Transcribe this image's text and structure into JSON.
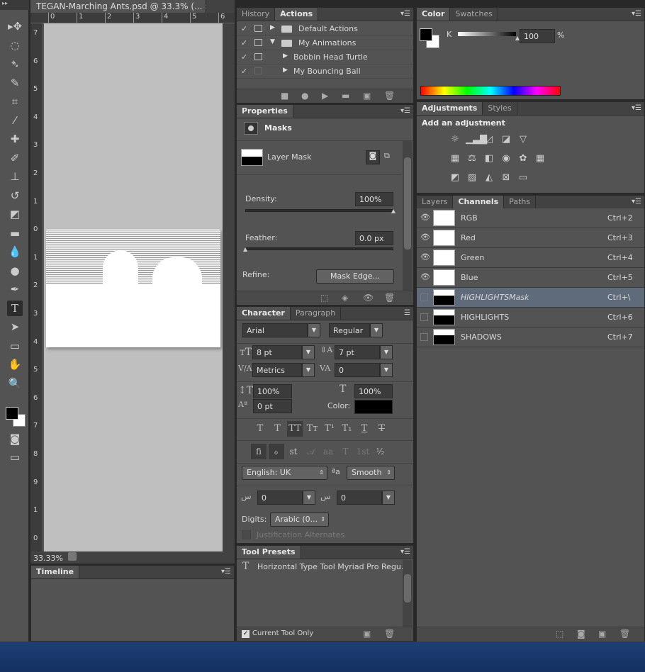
{
  "document": {
    "tab_title": "TEGAN-Marching Ants.psd @ 33.3% (...",
    "zoom": "33.33%",
    "ruler_top": [
      "0",
      "1",
      "2",
      "3",
      "4",
      "5",
      "6"
    ],
    "ruler_left": [
      "7",
      "6",
      "5",
      "4",
      "3",
      "2",
      "1",
      "0",
      "1",
      "2",
      "3",
      "4",
      "5",
      "6",
      "7",
      "8",
      "9",
      "1",
      "0"
    ]
  },
  "timeline": {
    "title": "Timeline"
  },
  "tools": [
    "move-icon",
    "marquee-icon",
    "lasso-icon",
    "quick-select-icon",
    "crop-icon",
    "eyedropper-icon",
    "healing-icon",
    "brush-icon",
    "stamp-icon",
    "history-brush-icon",
    "eraser-icon",
    "gradient-icon",
    "blur-icon",
    "dodge-icon",
    "pen-icon",
    "type-icon",
    "path-select-icon",
    "rectangle-icon",
    "hand-icon",
    "zoom-icon"
  ],
  "history_panel": {
    "tabs": [
      "History",
      "Actions"
    ],
    "actions": [
      {
        "label": "Default Actions",
        "folder": true,
        "expanded": false,
        "indent": 0
      },
      {
        "label": "My Animations",
        "folder": true,
        "expanded": true,
        "indent": 0
      },
      {
        "label": "Bobbin Head Turtle",
        "folder": false,
        "expanded": false,
        "indent": 1
      },
      {
        "label": "My Bouncing Ball",
        "folder": false,
        "expanded": false,
        "indent": 1
      }
    ]
  },
  "properties": {
    "tab": "Properties",
    "type": "Masks",
    "layer_mask_label": "Layer Mask",
    "density_label": "Density:",
    "density": "100%",
    "density_value": 100,
    "feather_label": "Feather:",
    "feather": "0.0 px",
    "feather_value": 0,
    "refine_label": "Refine:",
    "mask_edge_button": "Mask Edge..."
  },
  "character": {
    "tabs": [
      "Character",
      "Paragraph"
    ],
    "font": "Arial",
    "style": "Regular",
    "size": "8 pt",
    "leading": "7 pt",
    "kerning": "Metrics",
    "tracking": "0",
    "vscale": "100%",
    "hscale": "100%",
    "baseline": "0 pt",
    "color_label": "Color:",
    "color": "#000000",
    "type_buttons": [
      "T",
      "T",
      "TT",
      "Tт",
      "T¹",
      "T₁",
      "T",
      "T"
    ],
    "opentype_buttons": [
      "ﬁ",
      "ℴ",
      "st",
      "𝒜",
      "aa",
      "T",
      "1st",
      "½"
    ],
    "language": "English: UK",
    "aa_icon": "ªa",
    "antialias": "Smooth",
    "arabic1": "0",
    "arabic2": "0",
    "digits_label": "Digits:",
    "digits": "Arabic (0...",
    "justification_label": "Justification Alternates"
  },
  "tool_presets": {
    "title": "Tool Presets",
    "item": "Horizontal Type Tool Myriad Pro Regu...",
    "current_only": "Current Tool Only"
  },
  "color_panel": {
    "tabs": [
      "Color",
      "Swatches"
    ],
    "channel": "K",
    "value": "100",
    "unit": "%",
    "foreground": "#000000",
    "background": "#ffffff"
  },
  "adjustments": {
    "tabs": [
      "Adjustments",
      "Styles"
    ],
    "heading": "Add an adjustment"
  },
  "channels": {
    "tabs": [
      "Layers",
      "Channels",
      "Paths"
    ],
    "rows": [
      {
        "name": "RGB",
        "shortcut": "Ctrl+2",
        "visible": true,
        "selected": false
      },
      {
        "name": "Red",
        "shortcut": "Ctrl+3",
        "visible": true,
        "selected": false
      },
      {
        "name": "Green",
        "shortcut": "Ctrl+4",
        "visible": true,
        "selected": false
      },
      {
        "name": "Blue",
        "shortcut": "Ctrl+5",
        "visible": true,
        "selected": false
      },
      {
        "name": "HIGHLIGHTSMask",
        "shortcut": "Ctrl+\\",
        "visible": false,
        "selected": true
      },
      {
        "name": "HIGHLIGHTS",
        "shortcut": "Ctrl+6",
        "visible": false,
        "selected": false
      },
      {
        "name": "SHADOWS",
        "shortcut": "Ctrl+7",
        "visible": false,
        "selected": false
      }
    ]
  }
}
